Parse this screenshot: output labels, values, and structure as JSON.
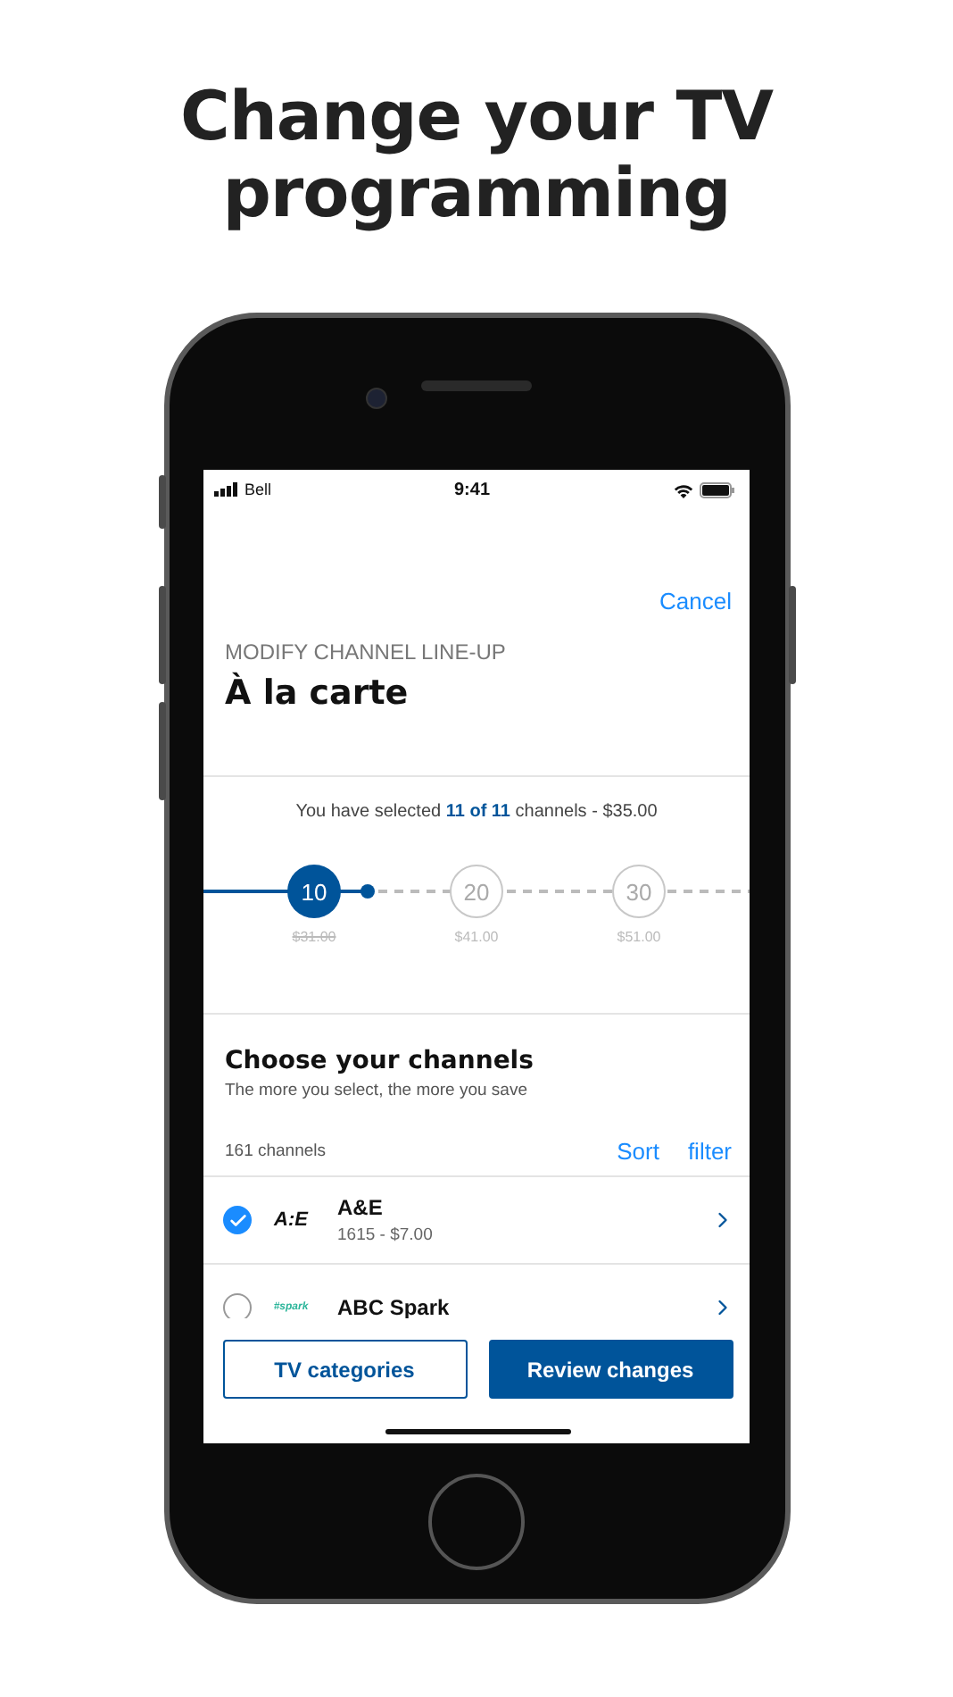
{
  "headline": "Change your TV programming",
  "status_bar": {
    "carrier": "Bell",
    "time": "9:41"
  },
  "header": {
    "cancel": "Cancel",
    "eyebrow": "MODIFY CHANNEL LINE-UP",
    "title": "À la carte"
  },
  "summary": {
    "text": "You have selected **11 of 11** channels - $35.00"
  },
  "tiers": {
    "level": 0.3,
    "steps": [
      {
        "label": "10",
        "price": "$31.00",
        "selected": true,
        "struck": true
      },
      {
        "label": "20",
        "price": "$41.00",
        "selected": false,
        "struck": false
      },
      {
        "label": "30",
        "price": "$51.00",
        "selected": false,
        "struck": false
      }
    ]
  },
  "channels_section": {
    "title": "Choose your channels",
    "subtitle": "The more you select, the more you save",
    "count": "161 channels",
    "sort": "Sort",
    "filter": "filter"
  },
  "channels": [
    {
      "name": "A&E",
      "logo": "A:E",
      "color": "#111111",
      "detail": "1615 - $7.00",
      "checked": true
    },
    {
      "name": "ABC Spark",
      "logo": "#spark",
      "color": "#2bb59a",
      "checked": false
    }
  ],
  "footer": {
    "secondary": "TV categories",
    "primary": "Review changes"
  }
}
